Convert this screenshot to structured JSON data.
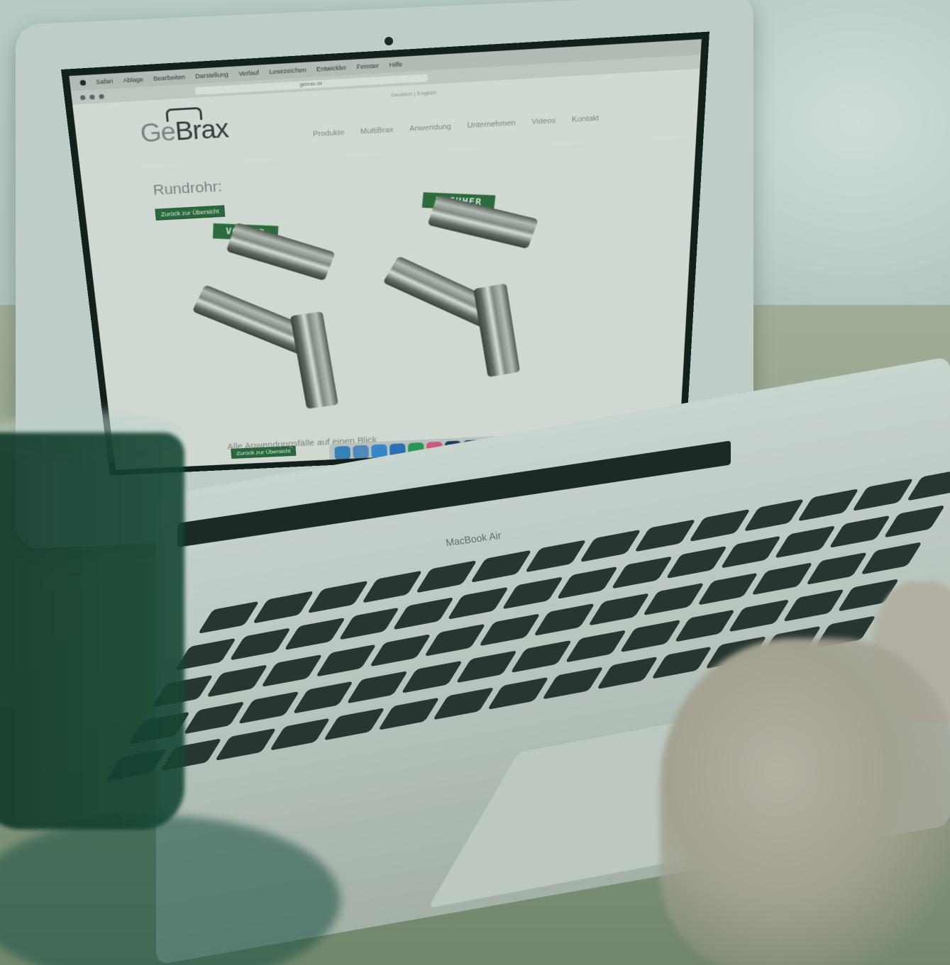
{
  "browser": {
    "menu_items": [
      "Safari",
      "Ablage",
      "Bearbeiten",
      "Darstellung",
      "Verlauf",
      "Lesezeichen",
      "Entwickler",
      "Fenster",
      "Hilfe"
    ],
    "url": "gebrax.de"
  },
  "site": {
    "languages": "Deutsch | English",
    "logo_ge": "Ge",
    "logo_brax": "Brax",
    "tagline": "",
    "nav": [
      "Produkte",
      "MultiBrax",
      "Anwendung",
      "Unternehmen",
      "Videos",
      "Kontakt"
    ]
  },
  "page": {
    "heading": "Rundrohr:",
    "back_button_top": "Zurück zur Übersicht",
    "back_button_bottom": "Zurück zur Übersicht",
    "before_label": "VORHER",
    "after_label": "NACHHER",
    "bottom_text": "Alle Anwendungsfälle auf einen Blick"
  },
  "device": {
    "brand": "MacBook Air"
  },
  "colors": {
    "brand_green": "#2d6a3b"
  }
}
